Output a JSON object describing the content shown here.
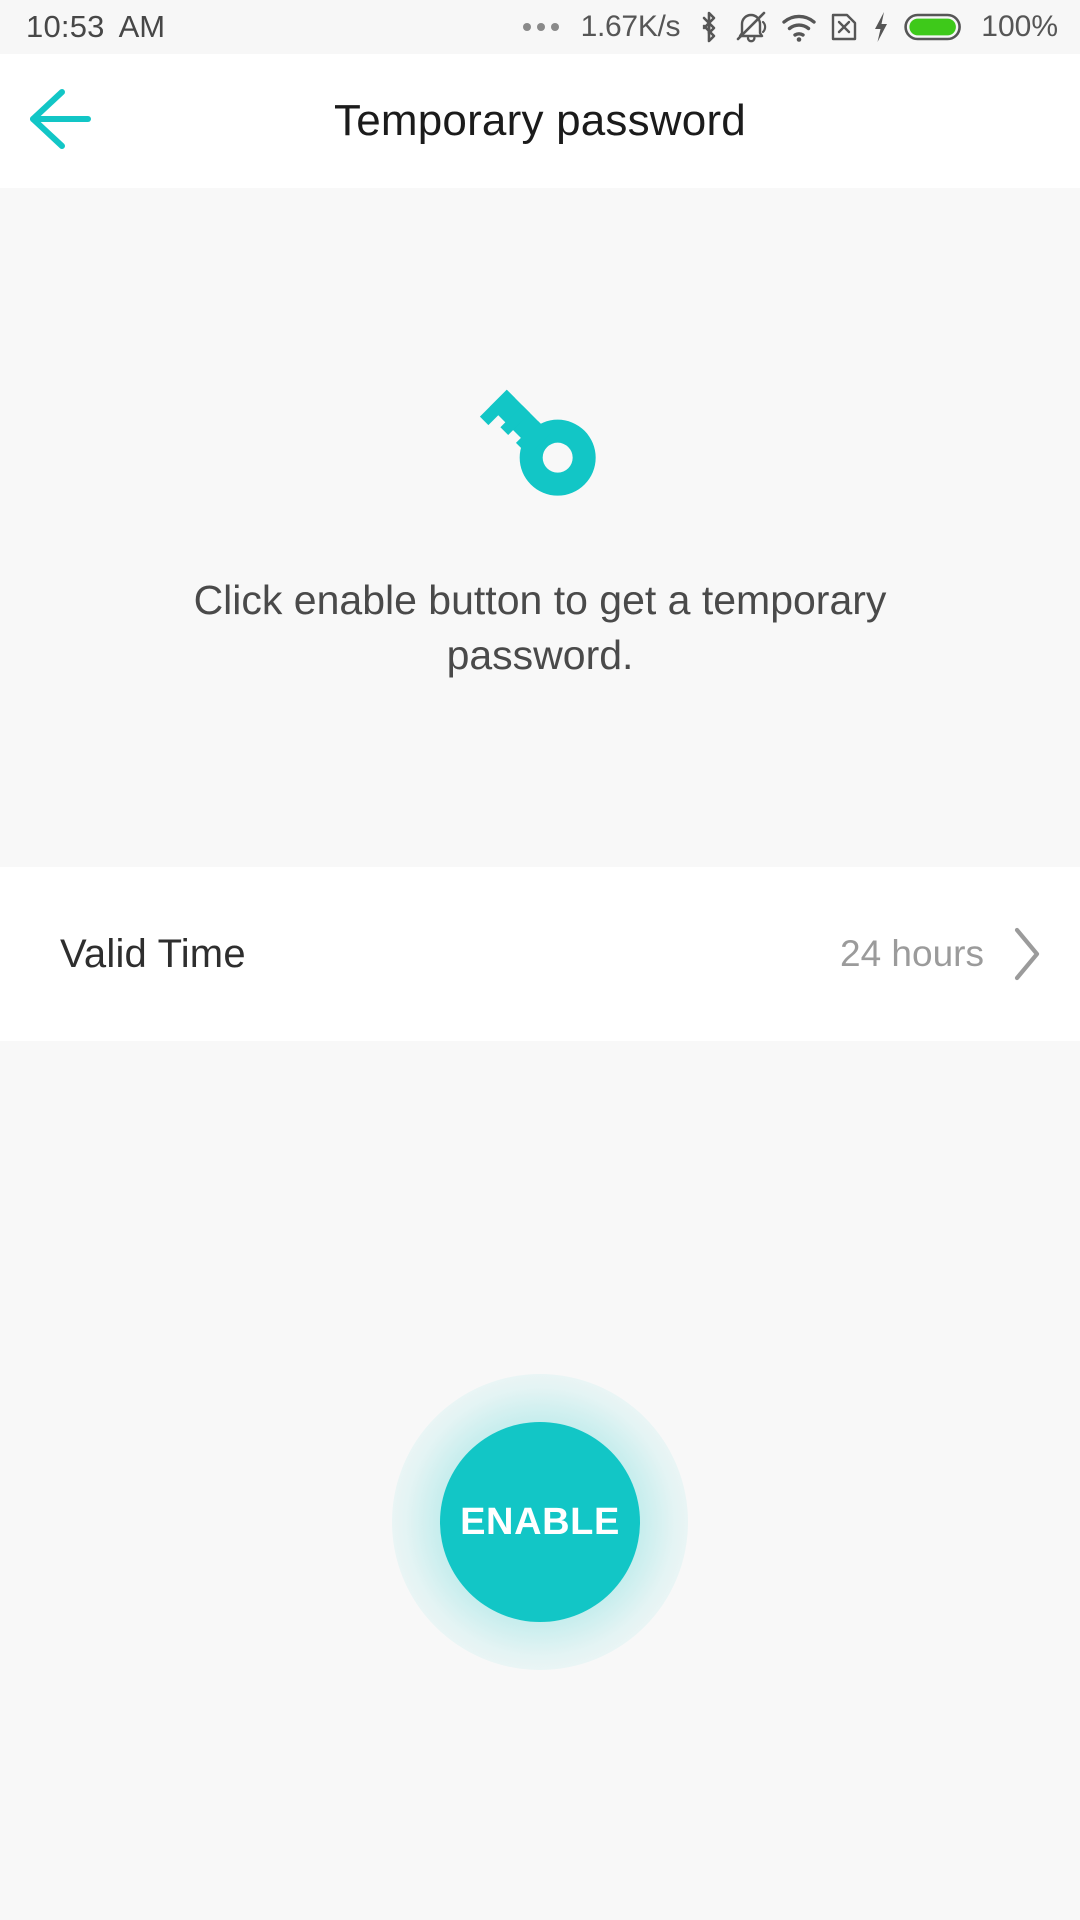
{
  "status_bar": {
    "time": "10:53",
    "ampm": "AM",
    "network_speed": "1.67K/s",
    "battery_percent": "100%",
    "icons": {
      "overflow": "more-dots-icon",
      "bluetooth": "bluetooth-icon",
      "silent": "bell-muted-icon",
      "wifi": "wifi-icon",
      "sim": "no-sim-icon",
      "charging": "lightning-bolt-icon",
      "battery": "battery-full-icon"
    },
    "colors": {
      "text": "#565656",
      "battery_fill": "#3ec91a",
      "background": "#f7f7f7"
    }
  },
  "header": {
    "title": "Temporary password",
    "back_icon": "back-arrow-icon",
    "accent": "#12c6c6",
    "background": "#ffffff"
  },
  "hero": {
    "icon": "key-icon",
    "icon_color": "#12c6c6",
    "message": "Click enable button to get a temporary password.",
    "background": "#f8f8f8"
  },
  "valid_time": {
    "label": "Valid Time",
    "value": "24 hours",
    "chevron_icon": "chevron-right-icon",
    "background": "#ffffff"
  },
  "enable": {
    "label": "ENABLE",
    "color": "#12c6c6",
    "text_color": "#ffffff"
  }
}
